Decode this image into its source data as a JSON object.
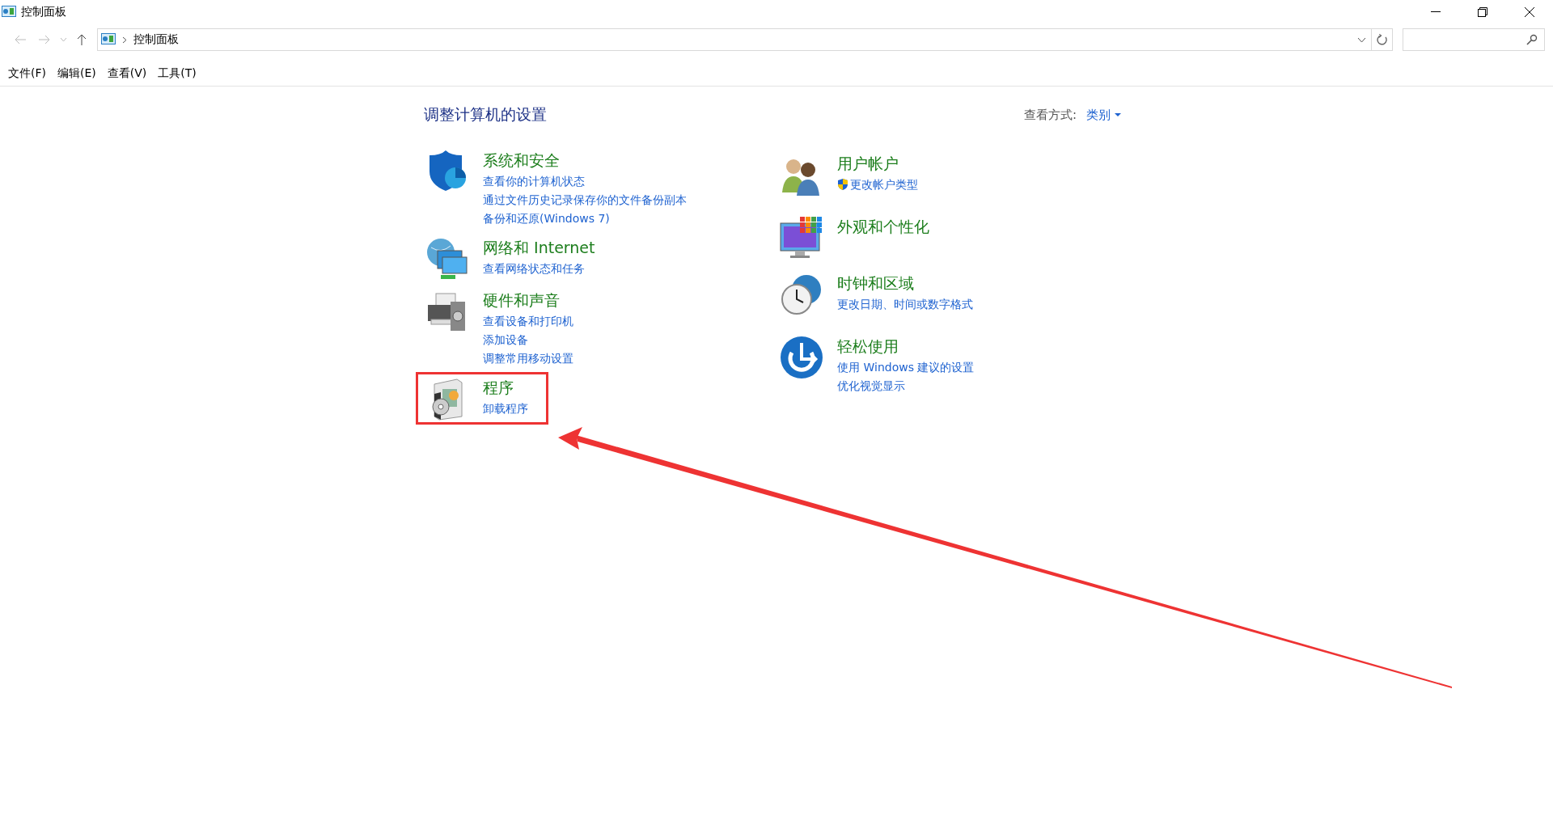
{
  "window": {
    "title": "控制面板"
  },
  "address_bar": {
    "path": "控制面板"
  },
  "menu": [
    {
      "label": "文件(F)"
    },
    {
      "label": "编辑(E)"
    },
    {
      "label": "查看(V)"
    },
    {
      "label": "工具(T)"
    }
  ],
  "heading": "调整计算机的设置",
  "view_by": {
    "label": "查看方式:",
    "value": "类别"
  },
  "left_column": [
    {
      "kind": "security",
      "title": "系统和安全",
      "highlighted": false,
      "links": [
        {
          "text": "查看你的计算机状态",
          "shield": false
        },
        {
          "text": "通过文件历史记录保存你的文件备份副本",
          "shield": false
        },
        {
          "text": "备份和还原(Windows 7)",
          "shield": false
        }
      ]
    },
    {
      "kind": "network",
      "title": "网络和 Internet",
      "highlighted": false,
      "links": [
        {
          "text": "查看网络状态和任务",
          "shield": false
        }
      ]
    },
    {
      "kind": "hardware",
      "title": "硬件和声音",
      "highlighted": false,
      "links": [
        {
          "text": "查看设备和打印机",
          "shield": false
        },
        {
          "text": "添加设备",
          "shield": false
        },
        {
          "text": "调整常用移动设置",
          "shield": false
        }
      ]
    },
    {
      "kind": "programs",
      "title": "程序",
      "highlighted": true,
      "links": [
        {
          "text": "卸载程序",
          "shield": false
        }
      ]
    }
  ],
  "right_column": [
    {
      "kind": "users",
      "title": "用户帐户",
      "highlighted": false,
      "links": [
        {
          "text": "更改帐户类型",
          "shield": true
        }
      ]
    },
    {
      "kind": "appearance",
      "title": "外观和个性化",
      "highlighted": false
    },
    {
      "kind": "clock",
      "title": "时钟和区域",
      "highlighted": false,
      "links": [
        {
          "text": "更改日期、时间或数字格式",
          "shield": false
        }
      ]
    },
    {
      "kind": "ease",
      "title": "轻松使用",
      "highlighted": false,
      "links": [
        {
          "text": "使用 Windows 建议的设置",
          "shield": false
        },
        {
          "text": "优化视觉显示",
          "shield": false
        }
      ]
    }
  ]
}
